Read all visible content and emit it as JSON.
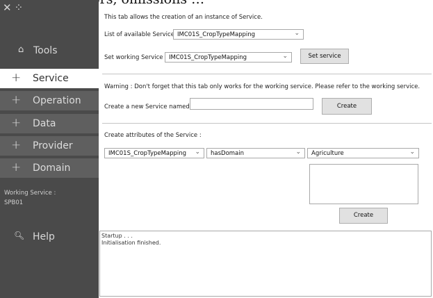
{
  "header_fragment": "introduce errors, omissions …",
  "sidebar": {
    "close_glyph": "✕",
    "move_glyph": "⁘",
    "tools_label": "Tools",
    "items": [
      {
        "label": "Service"
      },
      {
        "label": "Operation"
      },
      {
        "label": "Data"
      },
      {
        "label": "Provider"
      },
      {
        "label": "Domain"
      }
    ],
    "working_service_label": "Working Service :",
    "working_service_value": "SPB01",
    "help_label": "Help"
  },
  "main": {
    "intro_text": "This tab allows the creation of an instance of Service.",
    "list_label": "List of available Services :",
    "list_value": "IMC01S_CropTypeMapping",
    "working_label": "Set working Service :",
    "working_value": "IMC01S_CropTypeMapping",
    "set_service_button": "Set service",
    "warning_text": "Warning : Don't forget that this tab only works for the working service. Please refer to the working service.",
    "new_service_label": "Create a new Service named :",
    "new_service_value": "",
    "create_button": "Create",
    "attributes_label": "Create attributes of the Service :",
    "attr_service_value": "IMC01S_CropTypeMapping",
    "attr_property_value": "hasDomain",
    "attr_domain_value": "Agriculture",
    "attr_create_button": "Create"
  },
  "log": {
    "lines": [
      "Startup . . .",
      "Initialisation finished."
    ]
  }
}
